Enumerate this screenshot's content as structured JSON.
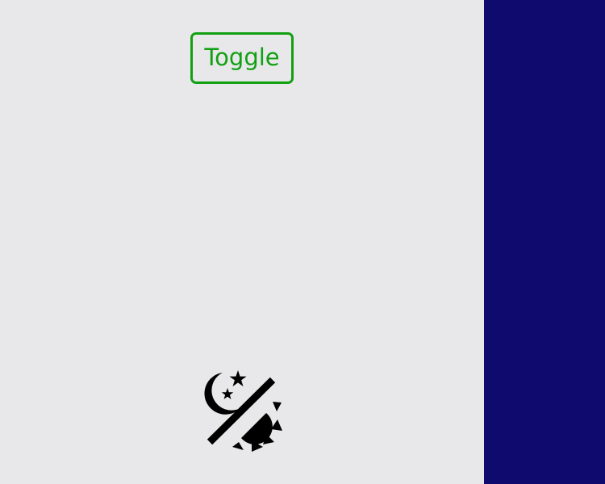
{
  "toggle": {
    "label": "Toggle"
  },
  "icons": {
    "theme": "day-night-theme-icon"
  },
  "colors": {
    "background": "#e8e8ea",
    "side_panel": "#0f0b6e",
    "toggle_accent": "#12a012",
    "icon": "#000000"
  }
}
